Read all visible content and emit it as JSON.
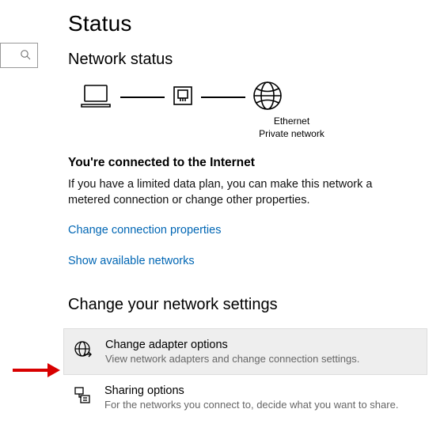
{
  "page_title": "Status",
  "network_status_heading": "Network status",
  "diagram": {
    "device_label": "Ethernet",
    "network_type": "Private network"
  },
  "connected_heading": "You're connected to the Internet",
  "connected_body": "If you have a limited data plan, you can make this network a metered connection or change other properties.",
  "link_change_props": "Change connection properties",
  "link_show_networks": "Show available networks",
  "settings_heading": "Change your network settings",
  "change_adapter": {
    "title": "Change adapter options",
    "desc": "View network adapters and change connection settings."
  },
  "sharing_options": {
    "title": "Sharing options",
    "desc": "For the networks you connect to, decide what you want to share."
  },
  "colors": {
    "link": "#0066b4",
    "highlight_bg": "#eeeeee",
    "annotation": "#d80000"
  }
}
